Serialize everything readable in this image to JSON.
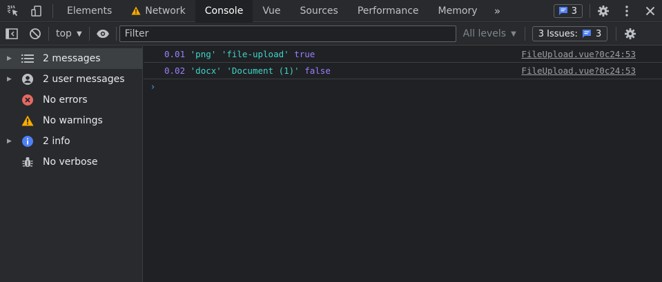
{
  "tabs": [
    {
      "label": "Elements"
    },
    {
      "label": "Network"
    },
    {
      "label": "Console"
    },
    {
      "label": "Vue"
    },
    {
      "label": "Sources"
    },
    {
      "label": "Performance"
    },
    {
      "label": "Memory"
    }
  ],
  "header": {
    "issues_count": "3"
  },
  "toolbar": {
    "context": "top",
    "filter_placeholder": "Filter",
    "levels": "All levels",
    "issues_label": "3 Issues:",
    "issues_count": "3"
  },
  "sidebar": {
    "items": [
      {
        "label": "2 messages"
      },
      {
        "label": "2 user messages"
      },
      {
        "label": "No errors"
      },
      {
        "label": "No warnings"
      },
      {
        "label": "2 info"
      },
      {
        "label": "No verbose"
      }
    ]
  },
  "console": {
    "rows": [
      {
        "num": "0.01",
        "a": "'png'",
        "b": "'file-upload'",
        "bool": "true",
        "source": "FileUpload.vue?0c24:53"
      },
      {
        "num": "0.02",
        "a": "'docx'",
        "b": "'Document (1)'",
        "bool": "false",
        "source": "FileUpload.vue?0c24:53"
      }
    ],
    "prompt": "›"
  },
  "colors": {
    "background": "#202124",
    "panel": "#292a2d",
    "number": "#9980ff",
    "string": "#3dd5c8",
    "prompt": "#4e9cf5",
    "error": "#e46962",
    "warning": "#f9ab00",
    "info": "#4e7ff5"
  }
}
